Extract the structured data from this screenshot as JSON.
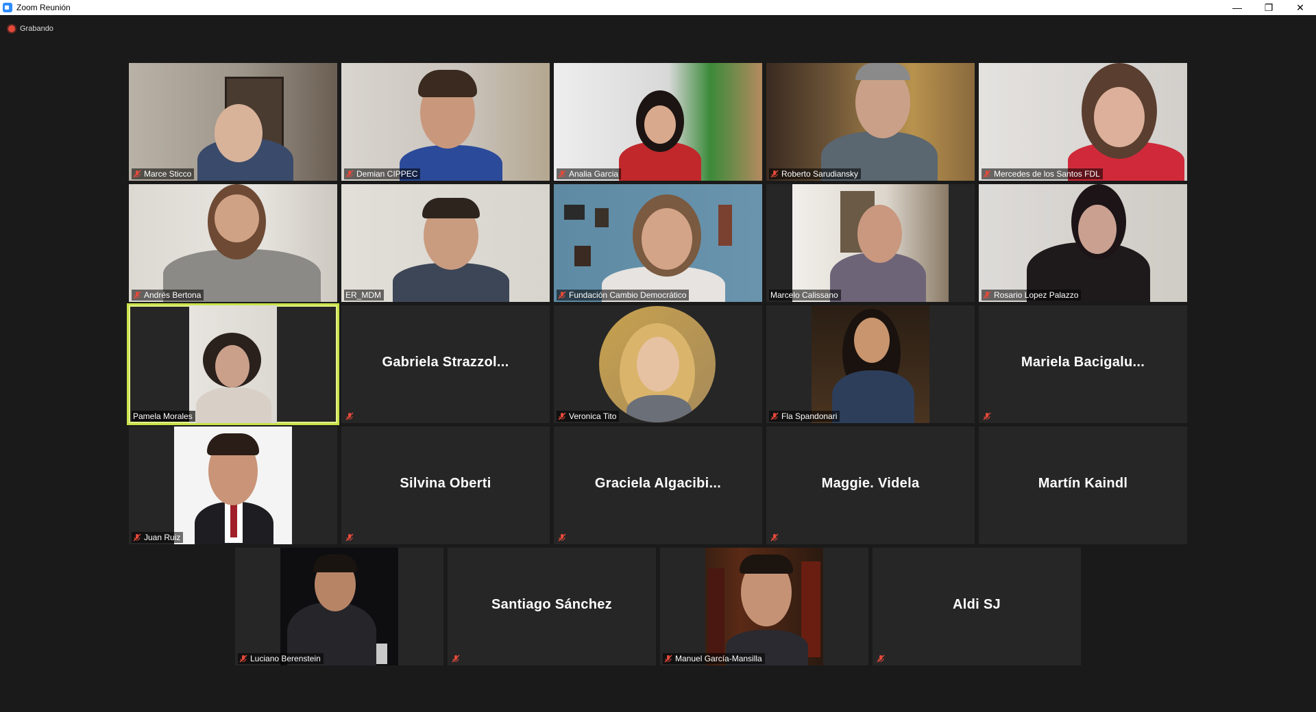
{
  "window": {
    "title": "Zoom Reunión",
    "minimize": "—",
    "restore": "❐",
    "close": "✕"
  },
  "status": {
    "recording_label": "Grabando"
  },
  "icons": {
    "muted_mic": "mic-muted-icon",
    "recording": "recording-dot-icon"
  },
  "colors": {
    "active_speaker_border": "#c7e24a",
    "muted_icon": "#e5493a",
    "tile_bg": "#262626"
  },
  "participants": [
    {
      "name": "Marce Sticco"
    },
    {
      "name": "Demian CIPPEC"
    },
    {
      "name": "Analia Garcia"
    },
    {
      "name": "Roberto Sarudiansky"
    },
    {
      "name": "Mercedes de los Santos FDL"
    },
    {
      "name": "Andrés Bertona"
    },
    {
      "name": "ER_MDM"
    },
    {
      "name": "Fundación Cambio Democrático"
    },
    {
      "name": "Marcelo Calissano"
    },
    {
      "name": "Rosario Lopez Palazzo"
    },
    {
      "name": "Pamela Morales"
    },
    {
      "name": "Gabriela  Strazzol..."
    },
    {
      "name": "Veronica Tito"
    },
    {
      "name": "Fla Spandonari"
    },
    {
      "name": "Mariela  Bacigalu..."
    },
    {
      "name": "Juan Ruiz"
    },
    {
      "name": "Silvina Oberti"
    },
    {
      "name": "Graciela  Algacibi..."
    },
    {
      "name": "Maggie. Videla"
    },
    {
      "name": "Martín Kaindl"
    },
    {
      "name": "Luciano Berenstein"
    },
    {
      "name": "Santiago Sánchez"
    },
    {
      "name": "Manuel García-Mansilla"
    },
    {
      "name": "Aldi SJ"
    }
  ]
}
